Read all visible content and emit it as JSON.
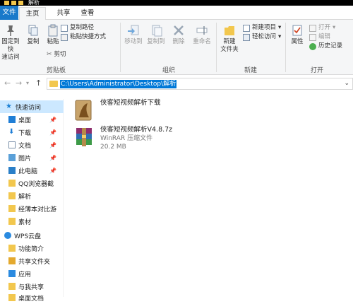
{
  "window": {
    "title": "解析"
  },
  "tabs": {
    "file": "文件",
    "home": "主页",
    "share": "共享",
    "view": "查看"
  },
  "ribbon": {
    "clipboard": {
      "pin_label_1": "固定到快",
      "pin_label_2": "速访问",
      "copy": "复制",
      "paste": "粘贴",
      "copy_path": "复制路径",
      "paste_shortcut": "粘贴快捷方式",
      "cut": "剪切",
      "group": "剪贴板"
    },
    "organize": {
      "move_to": "移动到",
      "copy_to": "复制到",
      "delete": "删除",
      "rename": "重命名",
      "group": "组织"
    },
    "new": {
      "new_folder_1": "新建",
      "new_folder_2": "文件夹",
      "new_item": "新建项目",
      "easy_access": "轻松访问",
      "group": "新建"
    },
    "open": {
      "properties": "属性",
      "open": "打开",
      "edit": "编辑",
      "history": "历史记录",
      "group": "打开"
    }
  },
  "address": {
    "path": "C:\\Users\\Administrator\\Desktop\\解析"
  },
  "sidebar": {
    "items": [
      {
        "label": "快速访问",
        "icon": "star-icon"
      },
      {
        "label": "桌面",
        "icon": "desktop-icon"
      },
      {
        "label": "下载",
        "icon": "download-icon"
      },
      {
        "label": "文档",
        "icon": "document-icon"
      },
      {
        "label": "图片",
        "icon": "picture-icon"
      },
      {
        "label": "此电脑",
        "icon": "computer-icon"
      },
      {
        "label": "QQ浏览器截",
        "icon": "folder-icon"
      },
      {
        "label": "解析",
        "icon": "folder-icon"
      },
      {
        "label": "经薄本对比游",
        "icon": "folder-icon"
      },
      {
        "label": "素材",
        "icon": "folder-icon"
      },
      {
        "label": "WPS云盘",
        "icon": "cloud-icon"
      },
      {
        "label": "功能简介",
        "icon": "folder-icon"
      },
      {
        "label": "共享文件夹",
        "icon": "share-folder-icon"
      },
      {
        "label": "应用",
        "icon": "apps-icon"
      },
      {
        "label": "与我共享",
        "icon": "folder-icon"
      },
      {
        "label": "桌面文档",
        "icon": "folder-icon"
      }
    ]
  },
  "files": [
    {
      "name": "侠客短视频解析下载",
      "type": "",
      "size": ""
    },
    {
      "name": "侠客短视频解析V4.8.7z",
      "type": "WinRAR 压缩文件",
      "size": "20.2 MB"
    }
  ],
  "colors": {
    "accent": "#0078d7",
    "file_tab": "#1979ca",
    "folder": "#f2c74e"
  }
}
